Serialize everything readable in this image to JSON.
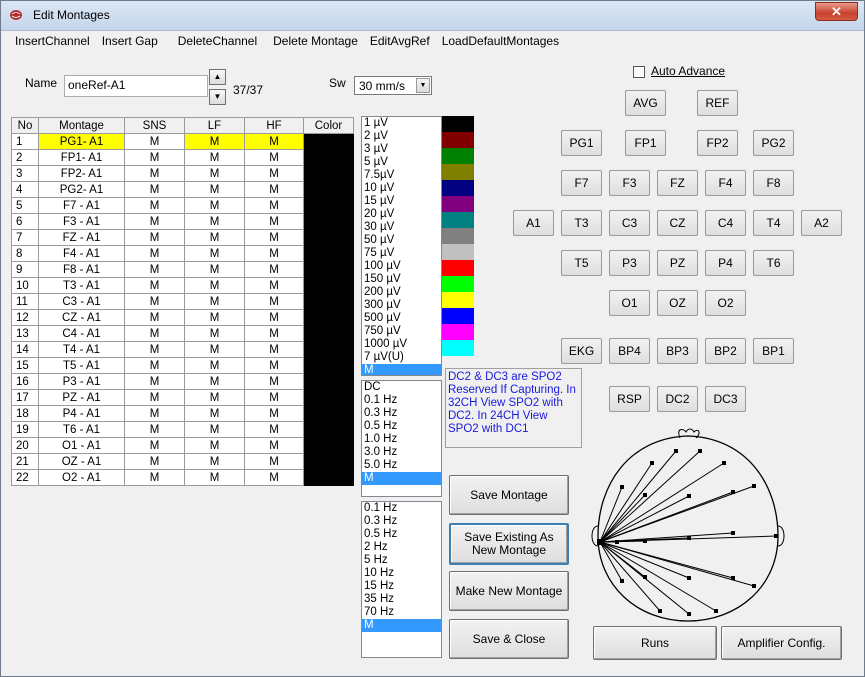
{
  "window": {
    "title": "Edit Montages",
    "close_label": "✕"
  },
  "menu": [
    "InsertChannel",
    "Insert Gap",
    "DeleteChannel",
    "Delete Montage",
    "EditAvgRef",
    "LoadDefaultMontages"
  ],
  "name_field": {
    "label": "Name",
    "value": "oneRef-A1",
    "counter": "37/37"
  },
  "sw_field": {
    "label": "Sw",
    "value": "30  mm/s"
  },
  "auto_advance": {
    "label": "Auto Advance",
    "checked": false
  },
  "table": {
    "headers": [
      "No",
      "Montage",
      "SNS",
      "LF",
      "HF",
      "Color"
    ],
    "rows": [
      [
        "1",
        "PG1- A1",
        "M",
        "M",
        "M"
      ],
      [
        "2",
        "FP1- A1",
        "M",
        "M",
        "M"
      ],
      [
        "3",
        "FP2- A1",
        "M",
        "M",
        "M"
      ],
      [
        "4",
        "PG2- A1",
        "M",
        "M",
        "M"
      ],
      [
        "5",
        "F7 - A1",
        "M",
        "M",
        "M"
      ],
      [
        "6",
        "F3 - A1",
        "M",
        "M",
        "M"
      ],
      [
        "7",
        "FZ - A1",
        "M",
        "M",
        "M"
      ],
      [
        "8",
        "F4 - A1",
        "M",
        "M",
        "M"
      ],
      [
        "9",
        "F8 - A1",
        "M",
        "M",
        "M"
      ],
      [
        "10",
        "T3 - A1",
        "M",
        "M",
        "M"
      ],
      [
        "11",
        "C3 - A1",
        "M",
        "M",
        "M"
      ],
      [
        "12",
        "CZ - A1",
        "M",
        "M",
        "M"
      ],
      [
        "13",
        "C4 - A1",
        "M",
        "M",
        "M"
      ],
      [
        "14",
        "T4 - A1",
        "M",
        "M",
        "M"
      ],
      [
        "15",
        "T5 - A1",
        "M",
        "M",
        "M"
      ],
      [
        "16",
        "P3 - A1",
        "M",
        "M",
        "M"
      ],
      [
        "17",
        "PZ - A1",
        "M",
        "M",
        "M"
      ],
      [
        "18",
        "P4 - A1",
        "M",
        "M",
        "M"
      ],
      [
        "19",
        "T6 - A1",
        "M",
        "M",
        "M"
      ],
      [
        "20",
        "O1 - A1",
        "M",
        "M",
        "M"
      ],
      [
        "21",
        "OZ - A1",
        "M",
        "M",
        "M"
      ],
      [
        "22",
        "O2 - A1",
        "M",
        "M",
        "M"
      ]
    ]
  },
  "sens_list": [
    "1   µV",
    "2   µV",
    "3   µV",
    "5   µV",
    "7.5µV",
    "10 µV",
    "15 µV",
    "20 µV",
    "30 µV",
    "50 µV",
    "75 µV",
    "100 µV",
    "150 µV",
    "200 µV",
    "300 µV",
    "500 µV",
    "750 µV",
    "1000 µV",
    "7 µV(U)",
    "M"
  ],
  "colors": [
    "#000000",
    "#800000",
    "#008000",
    "#808000",
    "#000080",
    "#800080",
    "#008080",
    "#808080",
    "#c0c0c0",
    "#ff0000",
    "#00ff00",
    "#ffff00",
    "#0000ff",
    "#ff00ff",
    "#00ffff"
  ],
  "lf_list": [
    "DC",
    "0.1 Hz",
    "0.3 Hz",
    "0.5 Hz",
    "1.0 Hz",
    "3.0 Hz",
    "5.0 Hz",
    "M"
  ],
  "hf_list": [
    "0.1 Hz",
    "0.3 Hz",
    "0.5 Hz",
    "2 Hz",
    "5 Hz",
    "10 Hz",
    "15 Hz",
    "35 Hz",
    "70 Hz",
    "M"
  ],
  "note": "DC2 & DC3 are SPO2 Reserved If Capturing. In 32CH View SPO2 with DC2. In 24CH View SPO2 with DC1",
  "actions": {
    "save_montage": "Save Montage",
    "save_existing": "Save Existing As New Montage",
    "make_new": "Make New Montage",
    "save_close": "Save & Close",
    "runs": "Runs",
    "amp_config": "Amplifier Config."
  },
  "electrodes": {
    "avg": "AVG",
    "ref": "REF",
    "pg1": "PG1",
    "fp1": "FP1",
    "fp2": "FP2",
    "pg2": "PG2",
    "f7": "F7",
    "f3": "F3",
    "fz": "FZ",
    "f4": "F4",
    "f8": "F8",
    "a1": "A1",
    "t3": "T3",
    "c3": "C3",
    "cz": "CZ",
    "c4": "C4",
    "t4": "T4",
    "a2": "A2",
    "t5": "T5",
    "p3": "P3",
    "pz": "PZ",
    "p4": "P4",
    "t6": "T6",
    "o1": "O1",
    "oz": "OZ",
    "o2": "O2",
    "ekg": "EKG",
    "bp4": "BP4",
    "bp3": "BP3",
    "bp2": "BP2",
    "bp1": "BP1",
    "rsp": "RSP",
    "dc2": "DC2",
    "dc3": "DC3"
  }
}
